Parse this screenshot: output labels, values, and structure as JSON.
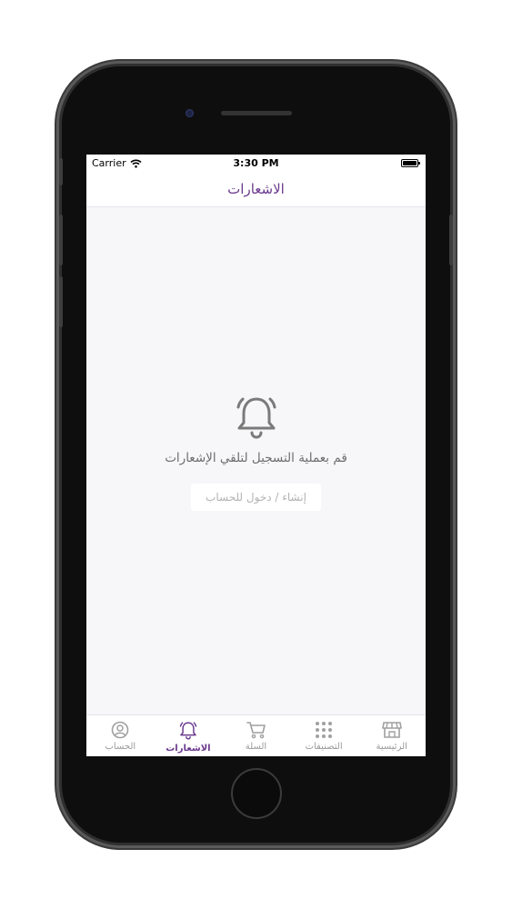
{
  "status_bar": {
    "carrier": "Carrier",
    "time": "3:30 PM"
  },
  "header": {
    "title": "الاشعارات"
  },
  "empty_state": {
    "icon": "bell-icon",
    "message": "قم بعملية التسجيل لتلقي الإشعارات",
    "button_label": "إنشاء / دخول للحساب"
  },
  "tabbar": {
    "active": "notifications",
    "items": [
      {
        "key": "home",
        "label": "الرئيسية",
        "icon": "store-icon"
      },
      {
        "key": "categories",
        "label": "التصنيفات",
        "icon": "grid-dots-icon"
      },
      {
        "key": "cart",
        "label": "السلة",
        "icon": "cart-icon"
      },
      {
        "key": "notifications",
        "label": "الاشعارات",
        "icon": "bell-icon"
      },
      {
        "key": "account",
        "label": "الحساب",
        "icon": "user-circle-icon"
      }
    ]
  },
  "colors": {
    "accent": "#6b3a8e",
    "inactive": "#9a9a9a",
    "background": "#f7f6f8"
  }
}
